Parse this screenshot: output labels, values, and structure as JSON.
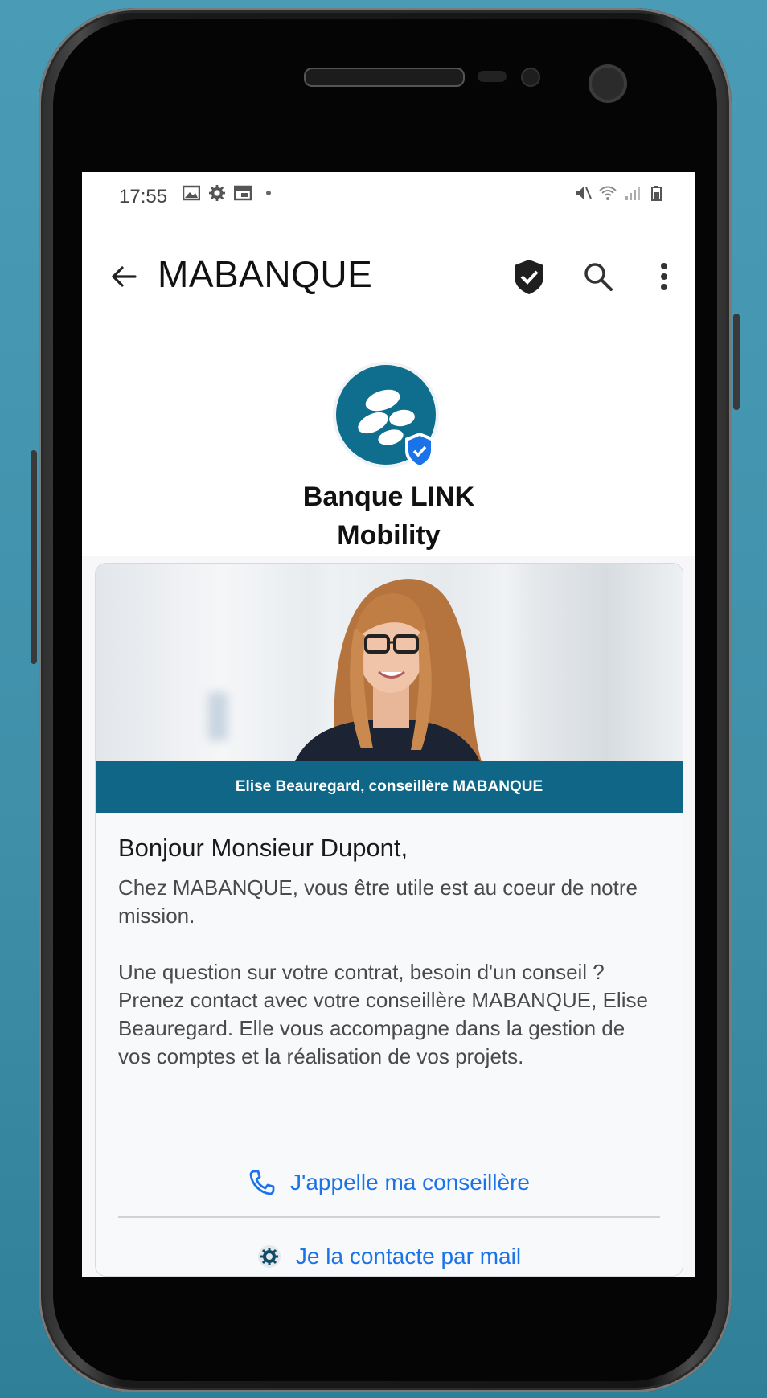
{
  "status_bar": {
    "time": "17:55",
    "left_icons": [
      "image-icon",
      "gear-icon",
      "calendar-icon",
      "dot-icon"
    ],
    "right_icons": [
      "mute-icon",
      "wifi-icon",
      "signal-icon",
      "battery-icon"
    ]
  },
  "app_bar": {
    "title": "MABANQUE",
    "icons": [
      "back-arrow-icon",
      "verified-shield-icon",
      "search-icon",
      "more-vert-icon"
    ]
  },
  "business": {
    "name_line1": "Banque LINK",
    "name_line2": "Mobility",
    "logo_color": "#0f6d8e",
    "verified_badge_color": "#1a73e8"
  },
  "card": {
    "image_caption": "Elise Beauregard, conseillère MABANQUE",
    "caption_bg": "#0f6687",
    "greeting": "Bonjour Monsieur Dupont,",
    "paragraph1": "Chez MABANQUE, vous être utile est au coeur de notre mission.",
    "paragraph2": "Une question sur votre contrat, besoin d'un conseil ? Prenez contact avec votre conseillère MABANQUE, Elise Beauregard. Elle vous accompagne dans la gestion de vos comptes et la réalisation de vos projets.",
    "actions": [
      {
        "label": "J'appelle ma conseillère",
        "icon": "phone-icon"
      },
      {
        "label": "Je la contacte par mail",
        "icon": "gear-icon"
      }
    ],
    "action_color": "#1a73e8"
  }
}
